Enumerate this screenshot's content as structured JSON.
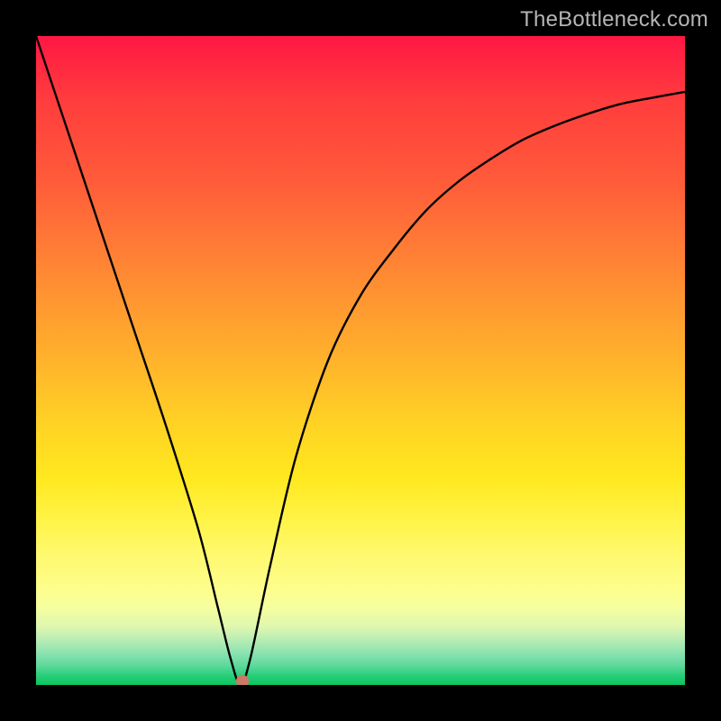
{
  "watermark": "TheBottleneck.com",
  "chart_data": {
    "type": "line",
    "title": "",
    "xlabel": "",
    "ylabel": "",
    "xlim": [
      0,
      100
    ],
    "ylim": [
      0,
      100
    ],
    "grid": false,
    "legend": false,
    "background": "rainbow-vertical",
    "series": [
      {
        "name": "bottleneck-curve",
        "x": [
          0,
          5,
          10,
          15,
          20,
          25,
          28,
          30,
          31.5,
          33,
          36,
          40,
          45,
          50,
          55,
          60,
          65,
          70,
          75,
          80,
          85,
          90,
          95,
          100
        ],
        "y": [
          100,
          85,
          70,
          55,
          40,
          24,
          12,
          4,
          0,
          4,
          18,
          35,
          50,
          60,
          67,
          73,
          77.5,
          81,
          84,
          86.2,
          88,
          89.5,
          90.5,
          91.4
        ]
      }
    ],
    "markers": [
      {
        "name": "result-dot",
        "x": 31.8,
        "y": 0.6,
        "color": "#cb7a66"
      }
    ],
    "gradient_stops": [
      {
        "pos": 0,
        "color": "#ff1744"
      },
      {
        "pos": 10,
        "color": "#ff3d3d"
      },
      {
        "pos": 22,
        "color": "#ff5a3a"
      },
      {
        "pos": 32,
        "color": "#ff7a36"
      },
      {
        "pos": 42,
        "color": "#ff9a30"
      },
      {
        "pos": 52,
        "color": "#ffb92a"
      },
      {
        "pos": 60,
        "color": "#ffd324"
      },
      {
        "pos": 68,
        "color": "#ffe81f"
      },
      {
        "pos": 75,
        "color": "#fff44a"
      },
      {
        "pos": 80,
        "color": "#fff96f"
      },
      {
        "pos": 85,
        "color": "#fdfd8a"
      },
      {
        "pos": 88,
        "color": "#f6ff9e"
      },
      {
        "pos": 91,
        "color": "#dff7ae"
      },
      {
        "pos": 93,
        "color": "#b9edb4"
      },
      {
        "pos": 95,
        "color": "#8de3b0"
      },
      {
        "pos": 97,
        "color": "#5ed99c"
      },
      {
        "pos": 98.5,
        "color": "#2ace7a"
      },
      {
        "pos": 100,
        "color": "#09c75f"
      }
    ]
  }
}
